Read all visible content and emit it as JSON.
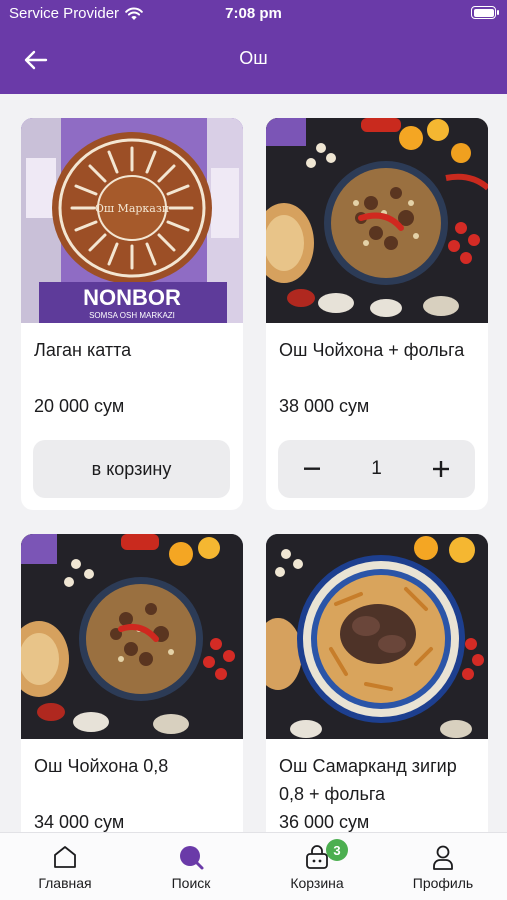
{
  "status_bar": {
    "carrier": "Service Provider",
    "time": "7:08 pm",
    "icons": [
      "wifi-icon",
      "battery-icon"
    ]
  },
  "header": {
    "title": "Ош",
    "back_icon": "arrow-left-icon",
    "background_color": "#6a3aa8"
  },
  "products": [
    {
      "name": "Лаган катта",
      "price": "20 000 сум",
      "action": "в корзину",
      "in_cart": false
    },
    {
      "name": "Ош Чойхона + фольга",
      "price": "38 000 сум",
      "in_cart": true,
      "quantity": "1",
      "minus_label": "−",
      "plus_label": "+"
    },
    {
      "name": "Ош Чойхона 0,8",
      "price": "34 000 сум"
    },
    {
      "name": "Ош Самарканд зигир 0,8 + фольга",
      "price": "36 000 сум"
    }
  ],
  "image_text": {
    "plate_logo": "Ош Маркази",
    "brand": "NONBOR",
    "brand_sub": "SOMSA OSH MARKAZI"
  },
  "tabbar": {
    "items": [
      {
        "label": "Главная",
        "icon": "home-icon"
      },
      {
        "label": "Поиск",
        "icon": "search-icon",
        "active": true
      },
      {
        "label": "Корзина",
        "icon": "basket-icon",
        "badge": "3"
      },
      {
        "label": "Профиль",
        "icon": "user-icon"
      }
    ],
    "accent_color": "#6a3aa8",
    "badge_color": "#4caf50"
  }
}
